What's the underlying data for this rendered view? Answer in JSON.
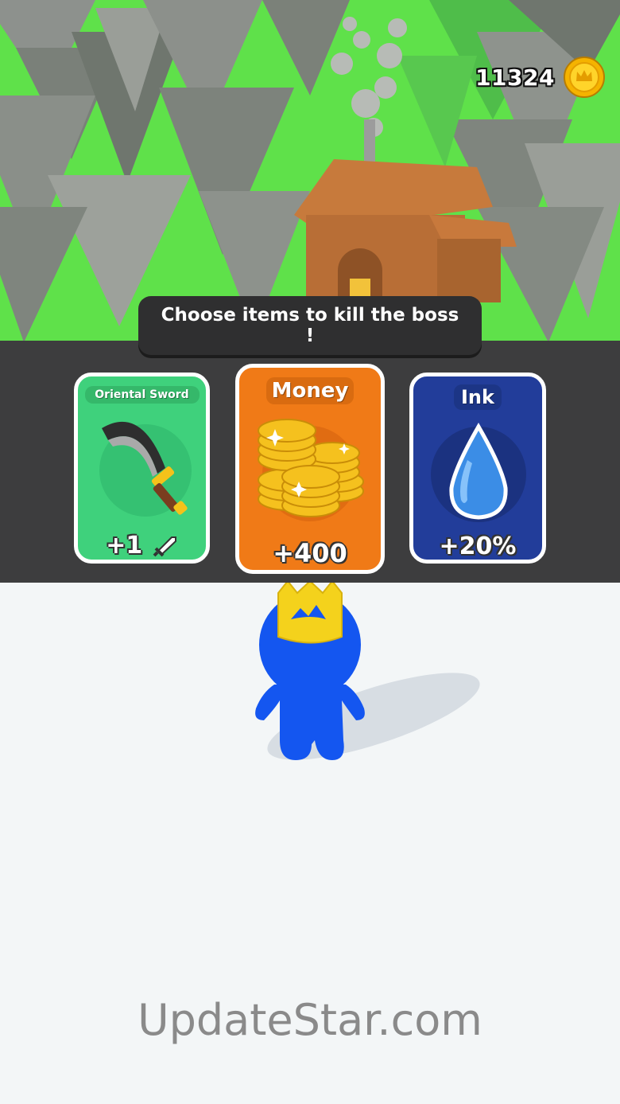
{
  "hud": {
    "coins": "11324",
    "coin_icon": "crown-coin-icon"
  },
  "banner": {
    "text": "Choose items to kill the boss !"
  },
  "cards": [
    {
      "title": "Oriental Sword",
      "value": "+1",
      "icon": "sword-icon",
      "bg": "#3fd17c"
    },
    {
      "title": "Money",
      "value": "+400",
      "icon": "coin-stack-icon",
      "bg": "#f07a17"
    },
    {
      "title": "Ink",
      "value": "+20%",
      "icon": "ink-drop-icon",
      "bg": "#223d9a"
    }
  ],
  "watermark": "UpdateStar.com",
  "colors": {
    "panel": "#3d3d3e",
    "banner": "#2f2f30",
    "grass": "#5fe14a",
    "player": "#1456f0",
    "crown": "#f4d21c"
  }
}
